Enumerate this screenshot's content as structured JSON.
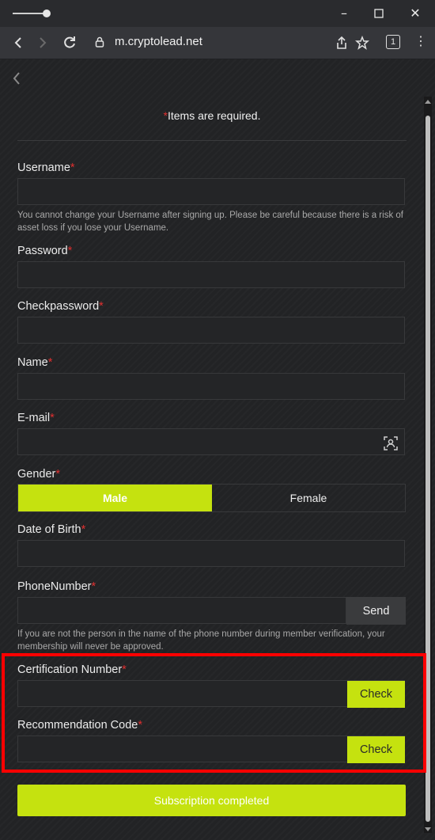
{
  "browser": {
    "url": "m.cryptolead.net",
    "tab_count": "1"
  },
  "form": {
    "required_note": "Items are required.",
    "required_mark": "*",
    "username": {
      "label": "Username",
      "value": "",
      "help": "You cannot change your Username after signing up. Please be careful because there is a risk of asset loss if you lose your Username."
    },
    "password": {
      "label": "Password",
      "value": ""
    },
    "checkpassword": {
      "label": "Checkpassword",
      "value": ""
    },
    "name": {
      "label": "Name",
      "value": ""
    },
    "email": {
      "label": "E-mail",
      "value": ""
    },
    "gender": {
      "label": "Gender",
      "options": [
        "Male",
        "Female"
      ],
      "selected": "Male"
    },
    "dob": {
      "label": "Date of Birth",
      "value": ""
    },
    "phone": {
      "label": "PhoneNumber",
      "value": "",
      "send_label": "Send",
      "help": "If you are not the person in the name of the phone number during member verification, your membership will never be approved."
    },
    "certification": {
      "label": "Certification Number",
      "value": "",
      "check_label": "Check"
    },
    "recommendation": {
      "label": "Recommendation Code",
      "value": "",
      "check_label": "Check"
    },
    "submit_label": "Subscription completed"
  },
  "colors": {
    "accent": "#c5e20f",
    "required": "#e03030",
    "highlight": "#ff0000"
  }
}
